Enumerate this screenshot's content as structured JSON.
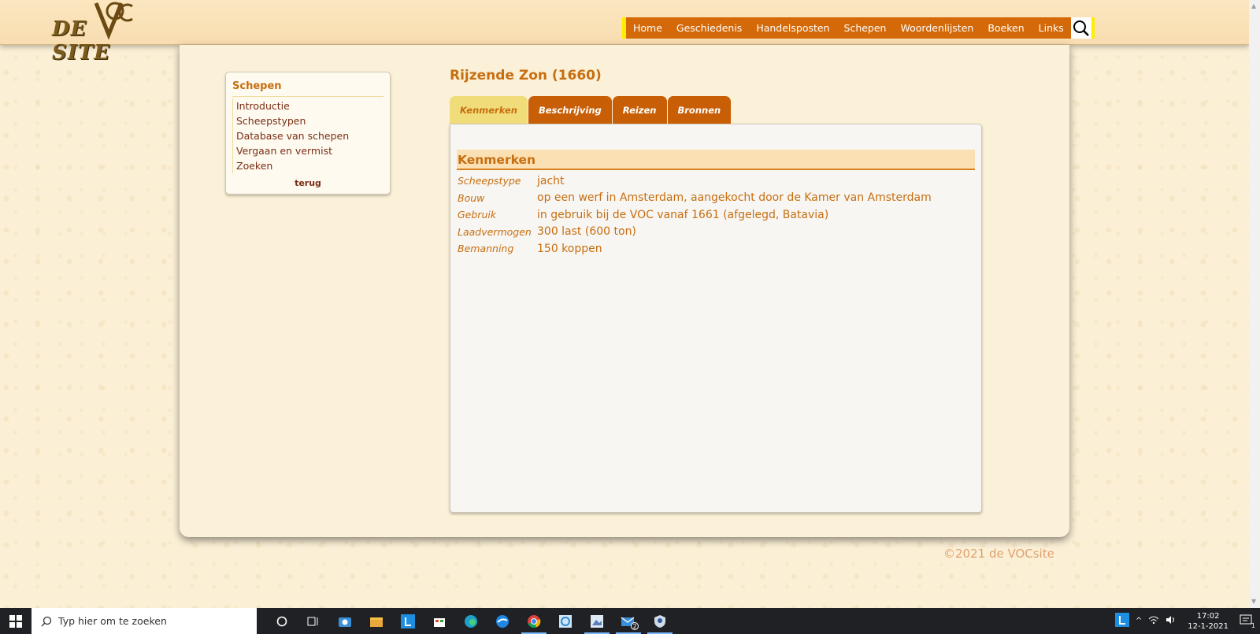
{
  "header": {
    "logo_text": "DE VOC SITE",
    "logo_mark": "VOC",
    "nav": [
      "Home",
      "Geschiedenis",
      "Handelsposten",
      "Schepen",
      "Woordenlijsten",
      "Boeken",
      "Links"
    ]
  },
  "sidebar": {
    "title": "Schepen",
    "items": [
      "Introductie",
      "Scheepstypen",
      "Database van schepen",
      "Vergaan en vermist",
      "Zoeken"
    ],
    "back": "terug"
  },
  "page": {
    "title": "Rijzende Zon (1660)",
    "tabs": [
      "Kenmerken",
      "Beschrijving",
      "Reizen",
      "Bronnen"
    ],
    "active_tab": "Kenmerken"
  },
  "kenmerken": {
    "heading": "Kenmerken",
    "rows": [
      {
        "label": "Scheepstype",
        "value": "jacht"
      },
      {
        "label": "Bouw",
        "value": "op een werf in Amsterdam, aangekocht door de Kamer van Amsterdam"
      },
      {
        "label": "Gebruik",
        "value": "in gebruik bij de VOC vanaf 1661 (afgelegd, Batavia)"
      },
      {
        "label": "Laadvermogen",
        "value": "300 last (600 ton)"
      },
      {
        "label": "Bemanning",
        "value": "150 koppen"
      }
    ]
  },
  "footer": {
    "copyright": "©2021 de VOCsite"
  },
  "taskbar": {
    "search_placeholder": "Typ hier om te zoeken",
    "time": "17:02",
    "date": "12-1-2021",
    "mail_badge": "2",
    "notification_count": "1"
  },
  "colors": {
    "accent": "#c76e10",
    "nav_bg": "#d4690a",
    "tab_bg": "#c85e06",
    "tab_active_bg": "#f1dc7a",
    "sidebar_link": "#7a2e14"
  }
}
